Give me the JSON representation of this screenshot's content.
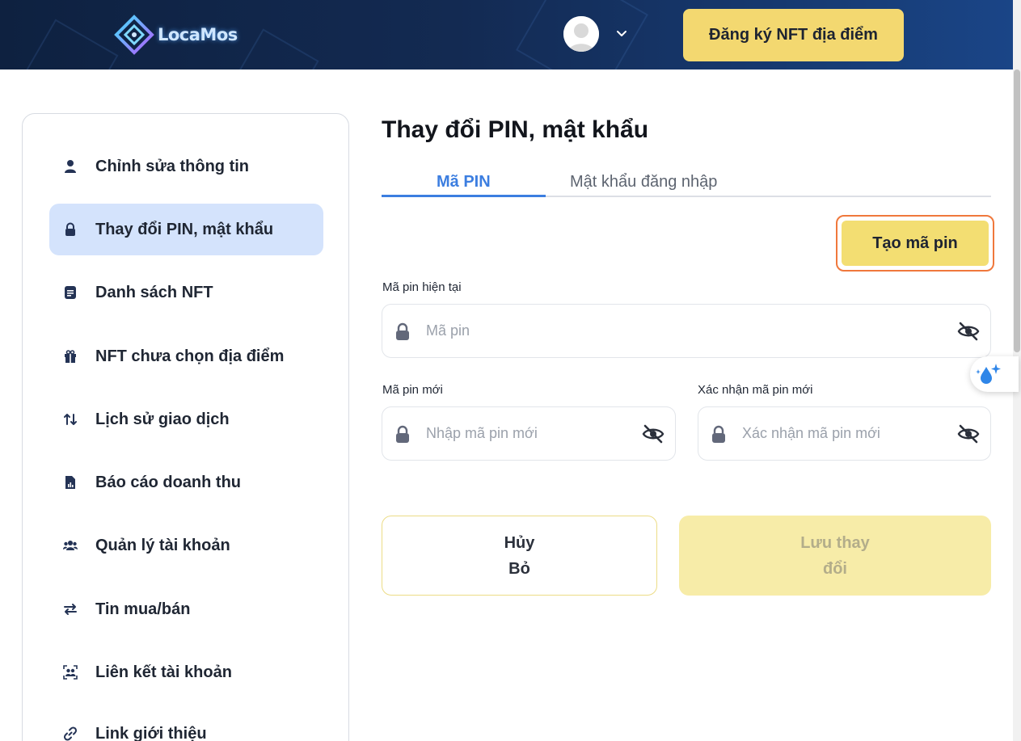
{
  "header": {
    "logo_text": "LocaMos",
    "register_button": "Đăng ký NFT địa điểm"
  },
  "sidebar": {
    "items": [
      {
        "label": "Chỉnh sửa thông tin",
        "icon": "user-icon"
      },
      {
        "label": "Thay đổi PIN, mật khẩu",
        "icon": "lock-icon",
        "active": true
      },
      {
        "label": "Danh sách NFT",
        "icon": "document-icon"
      },
      {
        "label": "NFT chưa chọn địa điểm",
        "icon": "gift-icon"
      },
      {
        "label": "Lịch sử giao dịch",
        "icon": "swap-vertical-icon"
      },
      {
        "label": "Báo cáo doanh thu",
        "icon": "report-icon"
      },
      {
        "label": "Quản lý tài khoản",
        "icon": "users-icon"
      },
      {
        "label": "Tin mua/bán",
        "icon": "swap-horizontal-icon"
      },
      {
        "label": "Liên kết tài khoản",
        "icon": "linked-accounts-icon"
      },
      {
        "label": "Link giới thiệu",
        "icon": "link-icon"
      }
    ]
  },
  "main": {
    "title": "Thay đổi PIN, mật khẩu",
    "tabs": [
      {
        "label": "Mã PIN",
        "active": true
      },
      {
        "label": "Mật khẩu đăng nhập",
        "active": false
      }
    ],
    "create_pin_button": "Tạo mã pin",
    "fields": {
      "current_pin": {
        "label": "Mã pin hiện tại",
        "placeholder": "Mã pin"
      },
      "new_pin": {
        "label": "Mã pin mới",
        "placeholder": "Nhập mã pin mới"
      },
      "confirm_pin": {
        "label": "Xác nhận mã pin mới",
        "placeholder": "Xác nhận mã pin mới"
      }
    },
    "cancel_button": {
      "line1": "Hủy",
      "line2": "Bỏ"
    },
    "save_button": {
      "line1": "Lưu thay",
      "line2": "đổi"
    }
  },
  "colors": {
    "header_bg": "#132a52",
    "accent_yellow": "#f3d870",
    "tab_active": "#3c7ee0",
    "sidebar_active_bg": "#d4e3fc",
    "highlight_border": "#f0783c"
  }
}
